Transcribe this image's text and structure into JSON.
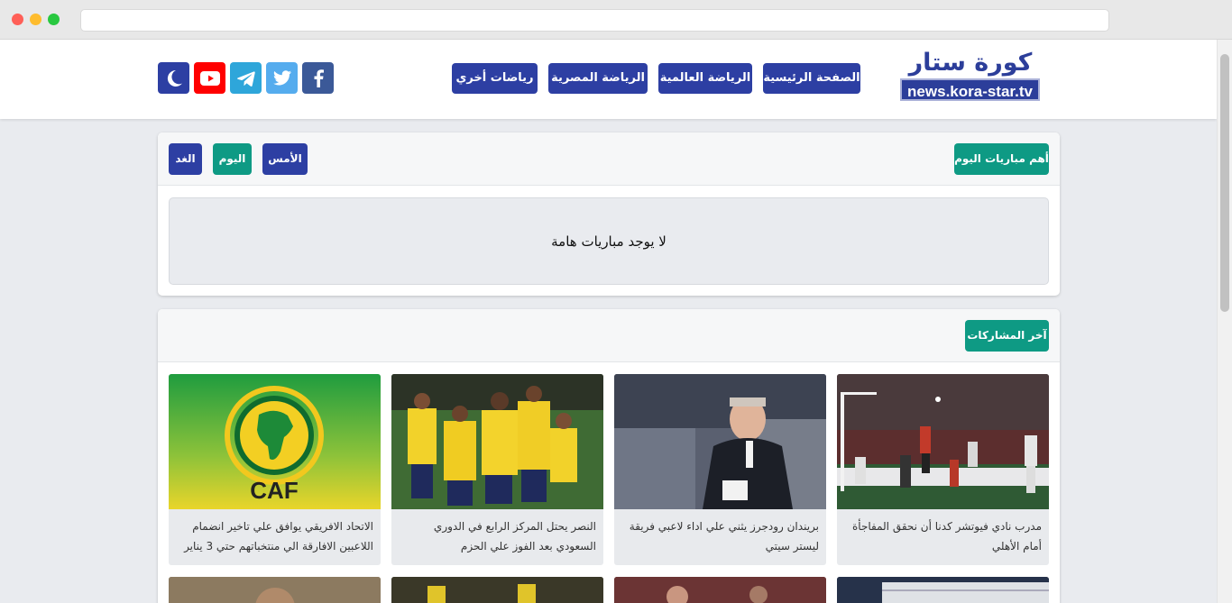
{
  "browser": {
    "url": ""
  },
  "logo": {
    "arabic": "كورة ستار",
    "url_text": "news.kora-star.tv"
  },
  "nav": {
    "home": "الصفحة الرئيسية",
    "world": "الرياضة العالمية",
    "egypt": "الرياضة المصرية",
    "other": "رياضات أخري"
  },
  "social": [
    "facebook-icon",
    "twitter-icon",
    "telegram-icon",
    "youtube-icon",
    "moon-icon"
  ],
  "matches": {
    "heading": "أهم مباريات اليوم",
    "yesterday": "الأمس",
    "today": "اليوم",
    "tomorrow": "الغد",
    "empty": "لا يوجد مباريات هامة"
  },
  "posts": {
    "heading": "آخر المشاركات",
    "cards": [
      {
        "title": "مدرب نادي فيوتشر كدنا أن نحقق المفاجأة أمام الأهلي"
      },
      {
        "title": "بريندان رودجرز يثني علي اداء لاعبي فريقة ليستر سيتي"
      },
      {
        "title": "النصر يحتل المركز الرابع في الدوري السعودي بعد الفوز علي الحزم"
      },
      {
        "title": "الاتحاد الافريقي يوافق علي تاخير انضمام اللاعبين الافارقة الي منتخباتهم حتي 3 يناير"
      }
    ],
    "caf_logo_text": "CAF"
  },
  "colors": {
    "brand": "#2d3fa3",
    "teal": "#0e9a84",
    "youtube": "#ff0000",
    "facebook": "#3b5998",
    "twitter": "#55acee",
    "telegram": "#2ea6da"
  }
}
